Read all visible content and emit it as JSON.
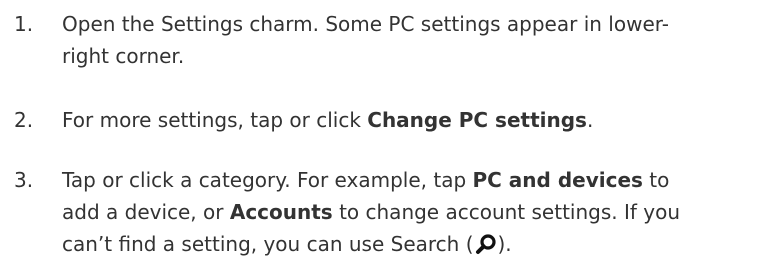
{
  "steps": [
    {
      "number": "1.",
      "line1": "Open the Settings charm. Some PC settings appear in lower-",
      "line2": "right corner."
    },
    {
      "number": "2.",
      "pre": "For more settings, tap or click ",
      "bold": "Change PC settings",
      "post": "."
    },
    {
      "number": "3.",
      "l1_pre": "Tap or click a category. For example, tap ",
      "l1_bold": "PC and devices",
      "l1_post": " to",
      "l2_pre": "add a device, or ",
      "l2_bold": "Accounts",
      "l2_post": " to change account settings. If you",
      "l3_pre": "can’t find a setting, you can use Search (",
      "l3_post": ").",
      "icon": "search-icon"
    }
  ]
}
